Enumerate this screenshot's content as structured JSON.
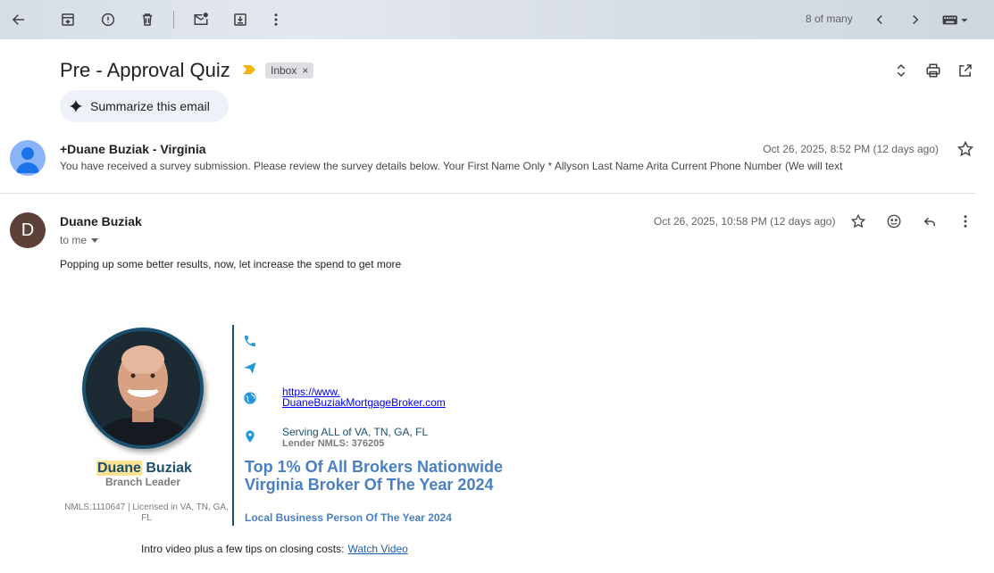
{
  "toolbar": {
    "pager": "8 of many"
  },
  "email": {
    "subject": "Pre - Approval Quiz",
    "label_chip": "Inbox",
    "label_remove": "×",
    "summarize_label": "Summarize this email"
  },
  "message1": {
    "sender": "+Duane Buziak - Virginia",
    "date": "Oct 26, 2025, 8:52 PM (12 days ago)",
    "snippet": "You have received a survey submission. Please review the survey details below. Your First Name Only * Allyson Last Name Arita Current Phone Number (We will text"
  },
  "message2": {
    "avatar_letter": "D",
    "sender": "Duane Buziak",
    "recipient": "to me",
    "date": "Oct 26, 2025, 10:58 PM (12 days ago)",
    "body": "Popping up some better results, now, let increase the spend to get more"
  },
  "signature": {
    "first_name": "Duane",
    "last_name": "Buziak",
    "role": "Branch Leader",
    "nmls": "NMLS:1110647 | Licensed in VA, TN, GA, FL",
    "website_line1": "https://www.",
    "website_line2": "DuaneBuziakMortgageBroker.com",
    "serving": "Serving ALL of VA, TN, GA, FL",
    "lender_nmls": "Lender NMLS: 376205",
    "award1": "Top 1% Of All Brokers Nationwide",
    "award2": "Virginia Broker Of The Year 2024",
    "award3": "Local Business Person Of The Year 2024",
    "intro_text": "Intro video plus a few tips on closing costs:",
    "watch_link": "Watch Video"
  },
  "colors": {
    "accent_blue": "#4a7fc1",
    "signature_navy": "#1b4f6e",
    "icon_blue": "#2196d9",
    "highlight": "#fde293"
  }
}
